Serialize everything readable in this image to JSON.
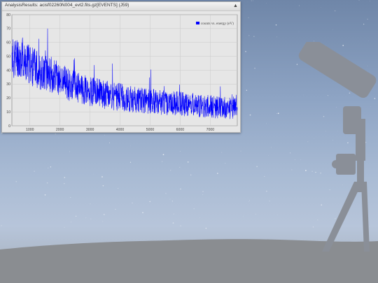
{
  "window": {
    "title": "AnalysisResults: acisf02260N004_evt2.fits.gz[EVENTS] (J59)",
    "collapse_icon": "triangle-up-icon"
  },
  "colors": {
    "series": "#0000ff",
    "plot_bg": "#e6e6e6"
  },
  "chart_data": {
    "type": "line",
    "title": "",
    "xlabel": "",
    "ylabel": "",
    "xlim": [
      400,
      7900
    ],
    "ylim": [
      0,
      80
    ],
    "x_ticks": [
      "1000",
      "2000",
      "3000",
      "4000",
      "5000",
      "6000",
      "7000"
    ],
    "y_ticks": [
      "0",
      "10",
      "20",
      "30",
      "40",
      "50",
      "60",
      "70",
      "80"
    ],
    "grid": true,
    "legend": "top-right",
    "series": [
      {
        "name": "counts vs. energy (eV)",
        "x": [
          400,
          600,
          800,
          1000,
          1200,
          1400,
          1600,
          1800,
          2000,
          2200,
          2400,
          2600,
          2800,
          3000,
          3200,
          3400,
          3600,
          3800,
          4000,
          4200,
          4400,
          4600,
          4800,
          5000,
          5200,
          5400,
          5600,
          5800,
          6000,
          6200,
          6400,
          6600,
          6800,
          7000,
          7200,
          7400,
          7600,
          7900
        ],
        "values": [
          48,
          50,
          46,
          44,
          41,
          39,
          38,
          36,
          33,
          31,
          29,
          27,
          26,
          25,
          24,
          23,
          22,
          21,
          21,
          20,
          19,
          19,
          18,
          18,
          17,
          17,
          16,
          16,
          16,
          15,
          15,
          14,
          14,
          14,
          13,
          13,
          13,
          12
        ]
      }
    ]
  }
}
